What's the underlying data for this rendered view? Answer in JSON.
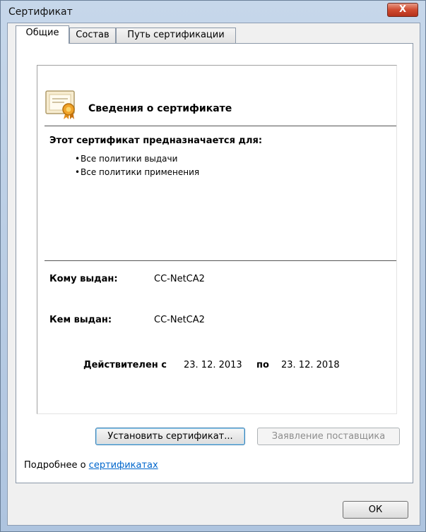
{
  "window": {
    "title": "Сертификат",
    "close_label": "X"
  },
  "tabs": [
    {
      "label": "Общие",
      "active": true
    },
    {
      "label": "Состав",
      "active": false
    },
    {
      "label": "Путь сертификации",
      "active": false
    }
  ],
  "info": {
    "title": "Сведения о сертификате",
    "purpose_heading": "Этот сертификат предназначается для:",
    "purposes": [
      "Все политики выдачи",
      "Все политики применения"
    ]
  },
  "fields": {
    "issued_to_label": "Кому выдан:",
    "issued_to_value": "CC-NetCA2",
    "issued_by_label": "Кем выдан:",
    "issued_by_value": "CC-NetCA2",
    "valid_from_label": "Действителен с",
    "valid_from_value": "23. 12. 2013",
    "valid_to_label": "по",
    "valid_to_value": "23. 12. 2018"
  },
  "buttons": {
    "install": "Установить сертификат...",
    "issuer_statement": "Заявление поставщика",
    "ok": "ОК"
  },
  "footer": {
    "text": "Подробнее о",
    "link": "сертификатах"
  },
  "colors": {
    "link": "#0066cc",
    "close": "#c7432a"
  }
}
